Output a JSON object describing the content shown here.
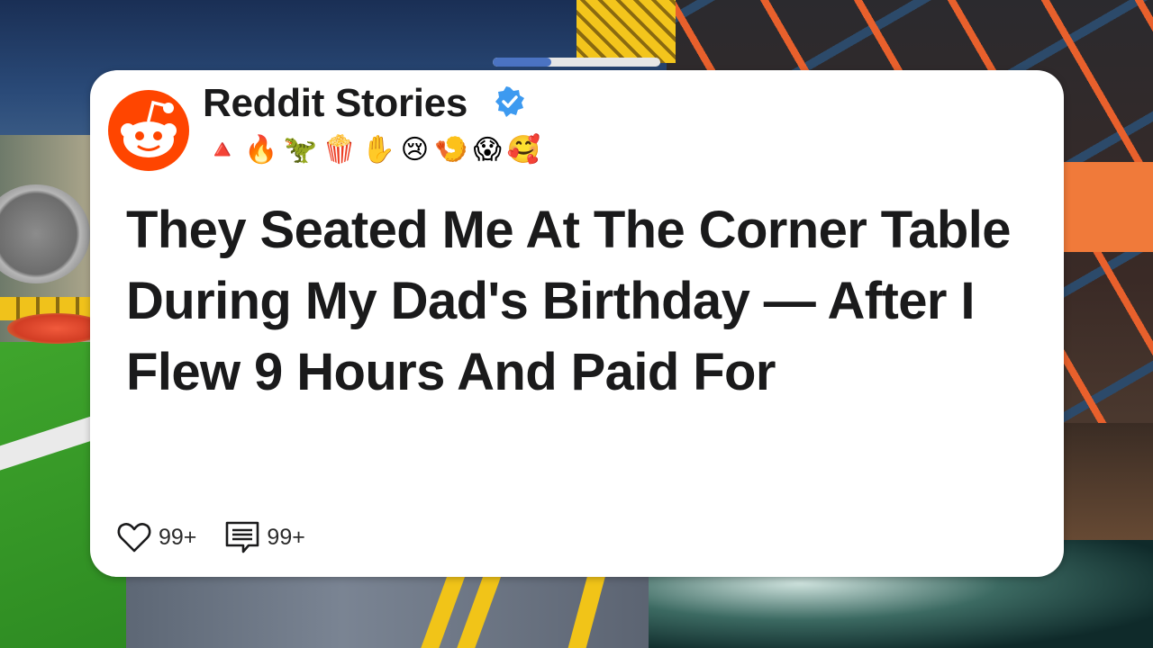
{
  "progress": {
    "value": 0.35,
    "fill_color": "#4b73c2"
  },
  "post": {
    "channel_name": "Reddit Stories",
    "verified_icon": "verified-badge-icon",
    "emoji_row": [
      "🔺",
      "🔥",
      "🦖",
      "🍿",
      "✋",
      "😢",
      "🍤",
      "😱",
      "🥰"
    ],
    "title": "They Seated Me At The Corner Table During My Dad's Birthday — After I Flew 9 Hours And Paid For",
    "likes": "99+",
    "comments": "99+",
    "brand_color": "#ff4500"
  }
}
